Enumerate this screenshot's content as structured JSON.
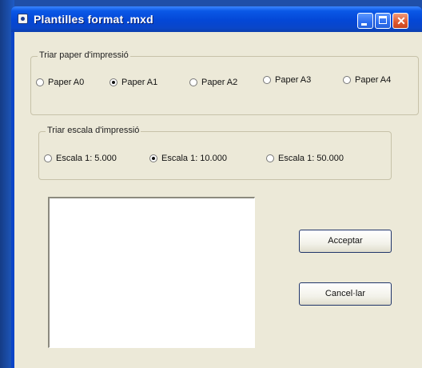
{
  "window": {
    "title": "Plantilles format .mxd"
  },
  "paper_group": {
    "label": "Triar paper d'impressió",
    "options": [
      {
        "label": "Paper A0",
        "checked": false
      },
      {
        "label": "Paper A1",
        "checked": true
      },
      {
        "label": "Paper A2",
        "checked": false
      },
      {
        "label": "Paper A3",
        "checked": false
      },
      {
        "label": "Paper A4",
        "checked": false
      }
    ]
  },
  "scale_group": {
    "label": "Triar escala d'impressió",
    "options": [
      {
        "label": "Escala 1: 5.000",
        "checked": false
      },
      {
        "label": "Escala 1: 10.000",
        "checked": true
      },
      {
        "label": "Escala 1: 50.000",
        "checked": false
      }
    ]
  },
  "buttons": {
    "accept": "Acceptar",
    "cancel": "Cancel·lar"
  },
  "titlebar_buttons": {
    "close_glyph": "✕"
  }
}
